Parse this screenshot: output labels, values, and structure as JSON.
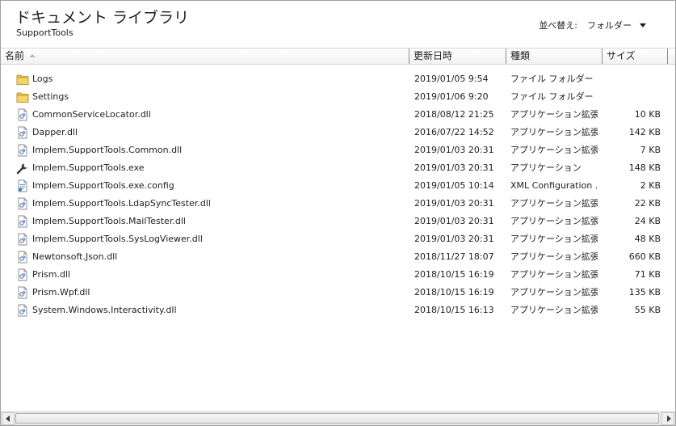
{
  "library": {
    "title": "ドキュメント ライブラリ",
    "subtitle": "SupportTools",
    "arrange_label": "並べ替え:",
    "arrange_value": "フォルダー"
  },
  "columns": {
    "name": "名前",
    "date": "更新日時",
    "type": "種類",
    "size": "サイズ"
  },
  "files": [
    {
      "name": "Logs",
      "date": "2019/01/05 9:54",
      "type": "ファイル フォルダー",
      "size": "",
      "icon": "folder-icon"
    },
    {
      "name": "Settings",
      "date": "2019/01/06 9:20",
      "type": "ファイル フォルダー",
      "size": "",
      "icon": "folder-icon"
    },
    {
      "name": "CommonServiceLocator.dll",
      "date": "2018/08/12 21:25",
      "type": "アプリケーション拡張",
      "size": "10 KB",
      "icon": "dll-icon"
    },
    {
      "name": "Dapper.dll",
      "date": "2016/07/22 14:52",
      "type": "アプリケーション拡張",
      "size": "142 KB",
      "icon": "dll-icon"
    },
    {
      "name": "Implem.SupportTools.Common.dll",
      "date": "2019/01/03 20:31",
      "type": "アプリケーション拡張",
      "size": "7 KB",
      "icon": "dll-icon"
    },
    {
      "name": "Implem.SupportTools.exe",
      "date": "2019/01/03 20:31",
      "type": "アプリケーション",
      "size": "148 KB",
      "icon": "wrench-icon"
    },
    {
      "name": "Implem.SupportTools.exe.config",
      "date": "2019/01/05 10:14",
      "type": "XML Configuration ...",
      "size": "2 KB",
      "icon": "config-icon"
    },
    {
      "name": "Implem.SupportTools.LdapSyncTester.dll",
      "date": "2019/01/03 20:31",
      "type": "アプリケーション拡張",
      "size": "22 KB",
      "icon": "dll-icon"
    },
    {
      "name": "Implem.SupportTools.MailTester.dll",
      "date": "2019/01/03 20:31",
      "type": "アプリケーション拡張",
      "size": "24 KB",
      "icon": "dll-icon"
    },
    {
      "name": "Implem.SupportTools.SysLogViewer.dll",
      "date": "2019/01/03 20:31",
      "type": "アプリケーション拡張",
      "size": "48 KB",
      "icon": "dll-icon"
    },
    {
      "name": "Newtonsoft.Json.dll",
      "date": "2018/11/27 18:07",
      "type": "アプリケーション拡張",
      "size": "660 KB",
      "icon": "dll-icon"
    },
    {
      "name": "Prism.dll",
      "date": "2018/10/15 16:19",
      "type": "アプリケーション拡張",
      "size": "71 KB",
      "icon": "dll-icon"
    },
    {
      "name": "Prism.Wpf.dll",
      "date": "2018/10/15 16:19",
      "type": "アプリケーション拡張",
      "size": "135 KB",
      "icon": "dll-icon"
    },
    {
      "name": "System.Windows.Interactivity.dll",
      "date": "2018/10/15 16:13",
      "type": "アプリケーション拡張",
      "size": "55 KB",
      "icon": "dll-icon"
    }
  ],
  "colors": {
    "folder": "#e8c04a",
    "header_border": "#d5d5d5",
    "text": "#1e1e1e"
  }
}
